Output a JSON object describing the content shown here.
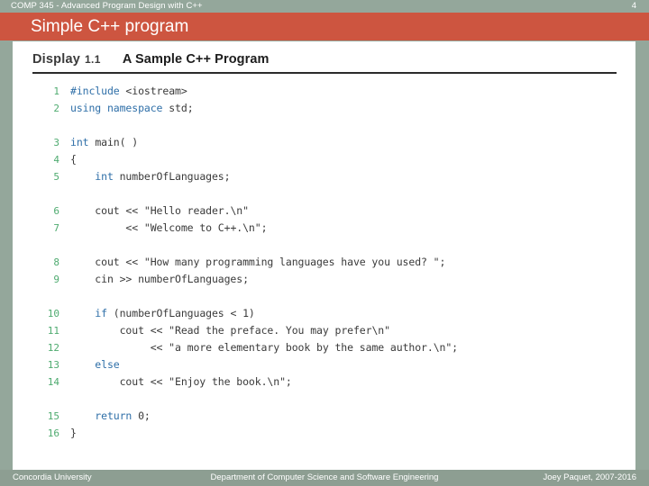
{
  "colors": {
    "band": "#94a79b",
    "title_band": "#cd5540",
    "footer_band": "#8d9e92",
    "panel": "#ffffff",
    "line_number": "#4fab70",
    "keyword": "#2f6fa8",
    "code_text": "#3a3a3a"
  },
  "topbar": {
    "course": "COMP 345 - Advanced Program Design with C++",
    "slide_number": "4"
  },
  "title": {
    "text": "Simple C++ program"
  },
  "display": {
    "label": "Display",
    "number": "1.1",
    "title": "A Sample C++ Program"
  },
  "code": {
    "rows": [
      {
        "num": "1",
        "text": "#include <iostream>"
      },
      {
        "num": "2",
        "text": "using namespace std;"
      },
      {
        "num": "",
        "text": ""
      },
      {
        "num": "3",
        "text": "int main( )"
      },
      {
        "num": "4",
        "text": "{"
      },
      {
        "num": "5",
        "text": "    int numberOfLanguages;"
      },
      {
        "num": "",
        "text": ""
      },
      {
        "num": "6",
        "text": "    cout << \"Hello reader.\\n\""
      },
      {
        "num": "7",
        "text": "         << \"Welcome to C++.\\n\";"
      },
      {
        "num": "",
        "text": ""
      },
      {
        "num": "8",
        "text": "    cout << \"How many programming languages have you used? \";"
      },
      {
        "num": "9",
        "text": "    cin >> numberOfLanguages;"
      },
      {
        "num": "",
        "text": ""
      },
      {
        "num": "10",
        "text": "    if (numberOfLanguages < 1)"
      },
      {
        "num": "11",
        "text": "        cout << \"Read the preface. You may prefer\\n\""
      },
      {
        "num": "12",
        "text": "             << \"a more elementary book by the same author.\\n\";"
      },
      {
        "num": "13",
        "text": "    else"
      },
      {
        "num": "14",
        "text": "        cout << \"Enjoy the book.\\n\";"
      },
      {
        "num": "",
        "text": ""
      },
      {
        "num": "15",
        "text": "    return 0;"
      },
      {
        "num": "16",
        "text": "}"
      }
    ]
  },
  "footer": {
    "left": "Concordia University",
    "center": "Department of Computer Science and Software Engineering",
    "right": "Joey Paquet, 2007-2016"
  }
}
